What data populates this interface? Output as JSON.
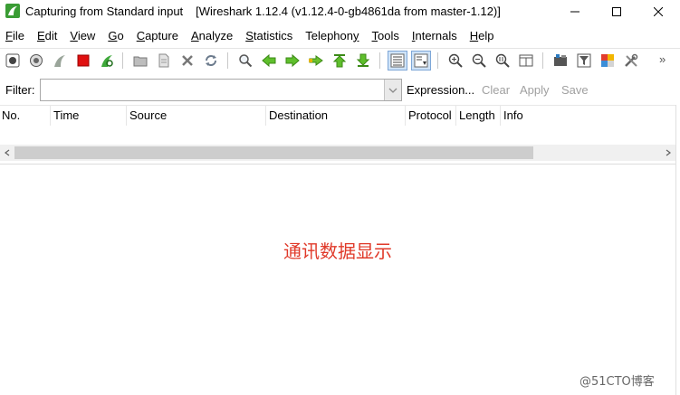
{
  "window": {
    "title": "Capturing from Standard input",
    "subtitle": "[Wireshark 1.12.4  (v1.12.4-0-gb4861da from master-1.12)]"
  },
  "menu": [
    {
      "u": "F",
      "rest": "ile"
    },
    {
      "u": "E",
      "rest": "dit"
    },
    {
      "u": "V",
      "rest": "iew"
    },
    {
      "u": "G",
      "rest": "o"
    },
    {
      "u": "C",
      "rest": "apture"
    },
    {
      "u": "A",
      "rest": "nalyze"
    },
    {
      "u": "S",
      "rest": "tatistics"
    },
    {
      "u": "",
      "rest": "Telephon",
      "u2": "y"
    },
    {
      "u": "T",
      "rest": "ools"
    },
    {
      "u": "I",
      "rest": "nternals"
    },
    {
      "u": "H",
      "rest": "elp"
    }
  ],
  "toolbar": {
    "icons": [
      "interfaces-icon",
      "options-icon",
      "start-capture-icon",
      "stop-capture-icon",
      "restart-capture-icon",
      "open-file-icon",
      "save-file-icon",
      "close-file-icon",
      "reload-icon",
      "find-icon",
      "back-icon",
      "forward-icon",
      "goto-packet-icon",
      "first-packet-icon",
      "last-packet-icon",
      "colorize-icon",
      "autoscroll-icon",
      "zoom-in-icon",
      "zoom-out-icon",
      "normal-size-icon",
      "resize-columns-icon",
      "capture-filters-icon",
      "display-filters-icon",
      "coloring-rules-icon",
      "preferences-icon"
    ],
    "more": "»"
  },
  "filter": {
    "label": "Filter:",
    "value": "",
    "expression": "Expression...",
    "clear": "Clear",
    "apply": "Apply",
    "save": "Save"
  },
  "columns": [
    "No.",
    "Time",
    "Source",
    "Destination",
    "Protocol",
    "Length",
    "Info"
  ],
  "annotation": "通讯数据显示",
  "watermark": "@51CTO博客",
  "colors": {
    "annotation": "#e03a2a",
    "accent": "#7ea7d8"
  }
}
